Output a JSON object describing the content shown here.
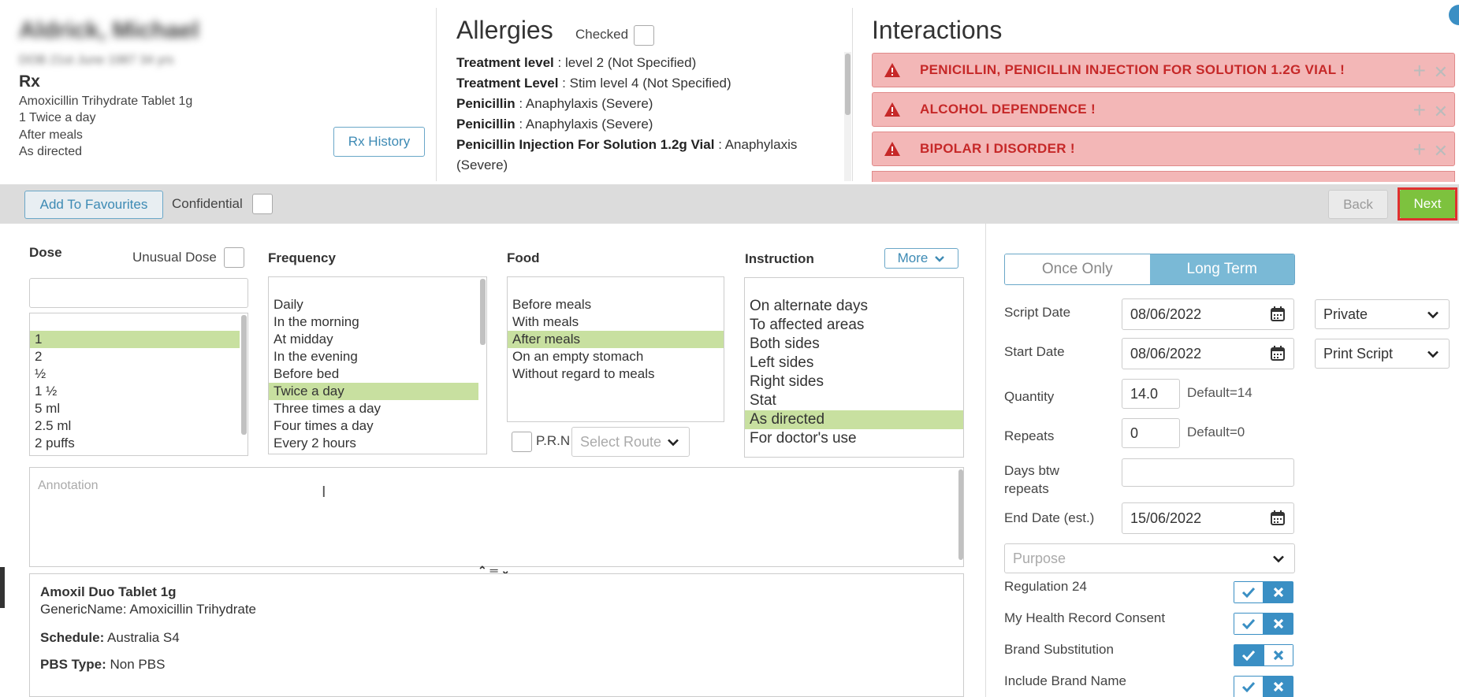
{
  "patient": {
    "name": "Aldrick, Michael",
    "details": "DOB 21st June 1987 34 yrs"
  },
  "rx": {
    "title": "Rx",
    "lines": [
      "Amoxicillin Trihydrate Tablet 1g",
      "1 Twice a day",
      "After meals",
      "As directed"
    ],
    "history_button": "Rx History"
  },
  "allergies": {
    "title": "Allergies",
    "checked_label": "Checked",
    "items": [
      {
        "name": "Treatment level",
        "value": " : level 2 (Not Specified)"
      },
      {
        "name": "Treatment Level",
        "value": " : Stim level 4 (Not Specified)"
      },
      {
        "name": "Penicillin",
        "value": " : Anaphylaxis (Severe)"
      },
      {
        "name": "Penicillin",
        "value": " : Anaphylaxis (Severe)"
      },
      {
        "name": "Penicillin Injection For Solution 1.2g Vial",
        "value": " : Anaphylaxis (Severe)"
      }
    ]
  },
  "interactions": {
    "title": "Interactions",
    "items": [
      "PENICILLIN, PENICILLIN INJECTION FOR SOLUTION 1.2G VIAL !",
      "ALCOHOL DEPENDENCE !",
      "BIPOLAR I DISORDER !"
    ],
    "colors": {
      "background": "#f3b7b7",
      "text": "#c62828"
    }
  },
  "toolbar": {
    "add_favourites": "Add To Favourites",
    "confidential": "Confidential",
    "back": "Back",
    "next": "Next"
  },
  "dose": {
    "title": "Dose",
    "unusual_label": "Unusual Dose",
    "value": "",
    "options": [
      "1",
      "2",
      "½",
      "1 ½",
      "5 ml",
      "2.5 ml",
      "2 puffs"
    ],
    "selected": "1"
  },
  "frequency": {
    "title": "Frequency",
    "options": [
      "Daily",
      "In the morning",
      "At midday",
      "In the evening",
      "Before bed",
      "Twice a day",
      "Three times a day",
      "Four times a day",
      "Every 2 hours"
    ],
    "selected": "Twice a day"
  },
  "food": {
    "title": "Food",
    "options": [
      "Before meals",
      "With meals",
      "After meals",
      "On an empty stomach",
      "Without regard to meals"
    ],
    "selected": "After meals",
    "prn_label": "P.R.N",
    "route_placeholder": "Select Route"
  },
  "instruction": {
    "title": "Instruction",
    "more_label": "More",
    "options": [
      "On alternate days",
      "To affected areas",
      "Both sides",
      "Left sides",
      "Right sides",
      "Stat",
      "As directed",
      "For doctor's use"
    ],
    "selected": "As directed"
  },
  "annotation": {
    "placeholder": "Annotation"
  },
  "drug_details": {
    "name": "Amoxil Duo Tablet 1g",
    "generic_label": "GenericName:",
    "generic_value": " Amoxicillin Trihydrate",
    "schedule_label": "Schedule:",
    "schedule_value": " Australia S4",
    "pbs_label": "PBS Type:",
    "pbs_value": " Non PBS"
  },
  "script": {
    "once_only": "Once Only",
    "long_term": "Long Term",
    "script_date_label": "Script Date",
    "script_date": "08/06/2022",
    "start_date_label": "Start Date",
    "start_date": "08/06/2022",
    "billing": "Private",
    "print_option": "Print Script",
    "quantity_label": "Quantity",
    "quantity": "14.0",
    "quantity_default": "Default=14",
    "repeats_label": "Repeats",
    "repeats": "0",
    "repeats_default": "Default=0",
    "days_btw_label_1": "Days btw",
    "days_btw_label_2": "repeats",
    "days_btw": "",
    "end_date_label": "End Date (est.)",
    "end_date": "15/06/2022",
    "purpose_placeholder": "Purpose",
    "toggles": [
      {
        "label": "Regulation 24",
        "state": "no"
      },
      {
        "label": "My Health Record Consent",
        "state": "no"
      },
      {
        "label": "Brand Substitution",
        "state": "yes"
      },
      {
        "label": "Include Brand Name",
        "state": "no"
      }
    ]
  }
}
